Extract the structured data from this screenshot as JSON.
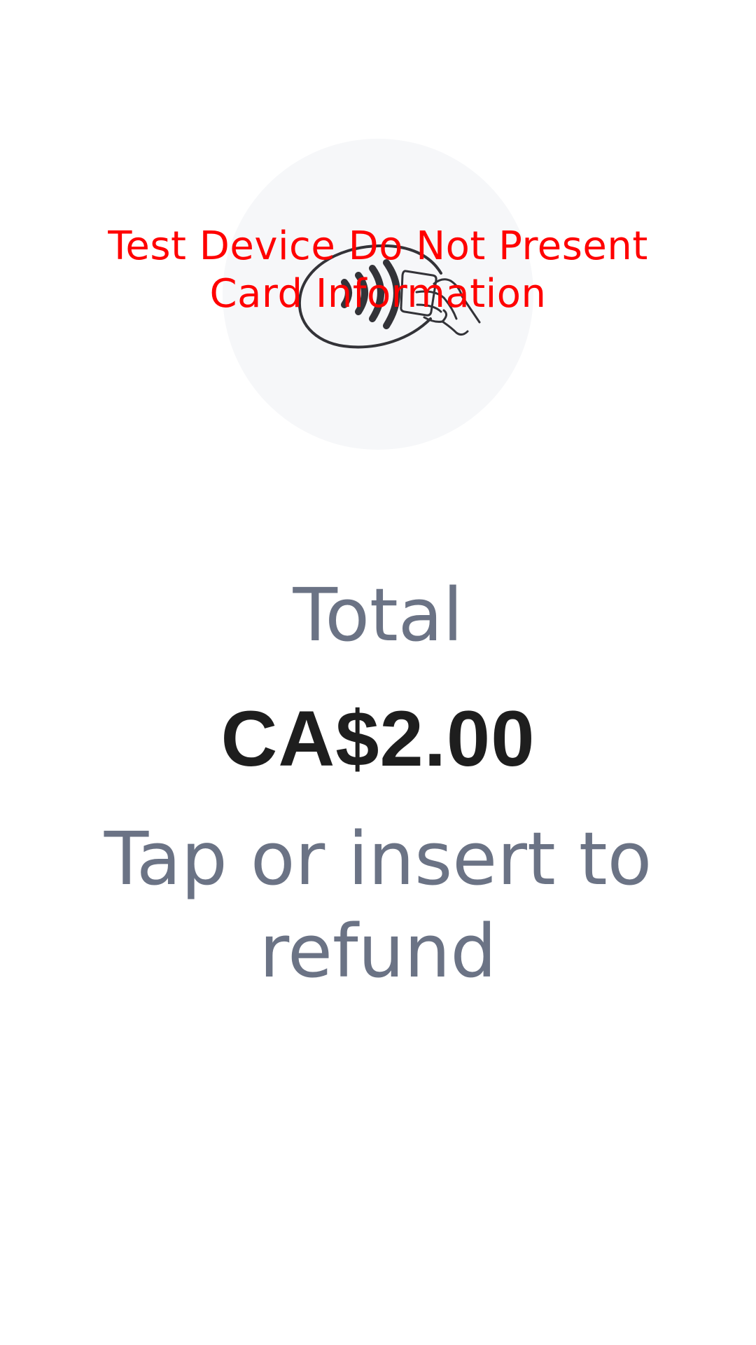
{
  "watermark": {
    "text": "Test Device Do Not Present Card Information"
  },
  "icon": {
    "name": "contactless-tap-icon",
    "circle_color": "#f6f7f9",
    "stroke_color": "#333338"
  },
  "payment": {
    "total_label": "Total",
    "amount": "CA$2.00",
    "instruction": "Tap or insert to refund"
  },
  "colors": {
    "watermark": "#ff0000",
    "secondary_text": "#6b7385",
    "primary_text": "#1e1e1e"
  }
}
